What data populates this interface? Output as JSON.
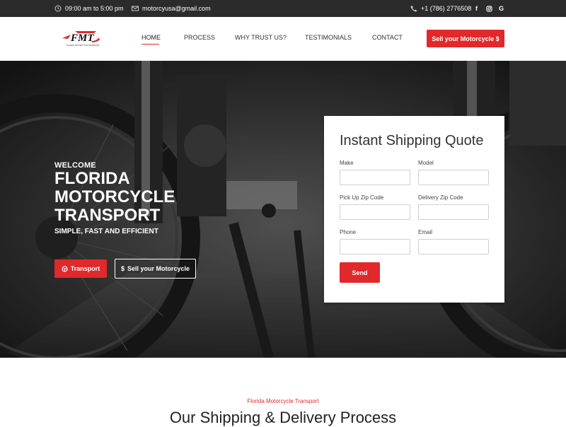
{
  "topbar": {
    "hours": "09:00 am to 5:00 pm",
    "email": "motorcyusa@gmail.com",
    "phone": "+1 (786) 2776508",
    "social": [
      "f",
      "instagram",
      "G"
    ]
  },
  "header": {
    "logo_text": "FMT",
    "logo_subtext": "FLORIDA MOTORCYCLE TRANSPORT",
    "nav": [
      "HOME",
      "PROCESS",
      "WHY TRUST US?",
      "TESTIMONIALS",
      "CONTACT"
    ],
    "cta_label": "Sell your Motorcycle $"
  },
  "hero": {
    "welcome": "WELCOME",
    "title": "FLORIDA MOTORCYCLE TRANSPORT",
    "tagline": "SIMPLE, FAST AND EFFICIENT",
    "btn_transport": "Transport",
    "btn_sell": "Sell your Motorcycle"
  },
  "quote_form": {
    "title": "Instant Shipping Quote",
    "fields": {
      "make": "Make",
      "model": "Model",
      "pickup_zip": "Pick Up Zip Code",
      "delivery_zip": "Delivery Zip Code",
      "phone": "Phone",
      "email": "Email"
    },
    "values": {
      "make": "",
      "model": "",
      "pickup_zip": "",
      "delivery_zip": "",
      "phone": "",
      "email": ""
    },
    "send_label": "Send"
  },
  "process_section": {
    "subtitle": "Florida Motorcycle Transport",
    "title": "Our Shipping & Delivery Process"
  },
  "colors": {
    "accent": "#e1282b",
    "topbar": "#2b2b2b"
  }
}
